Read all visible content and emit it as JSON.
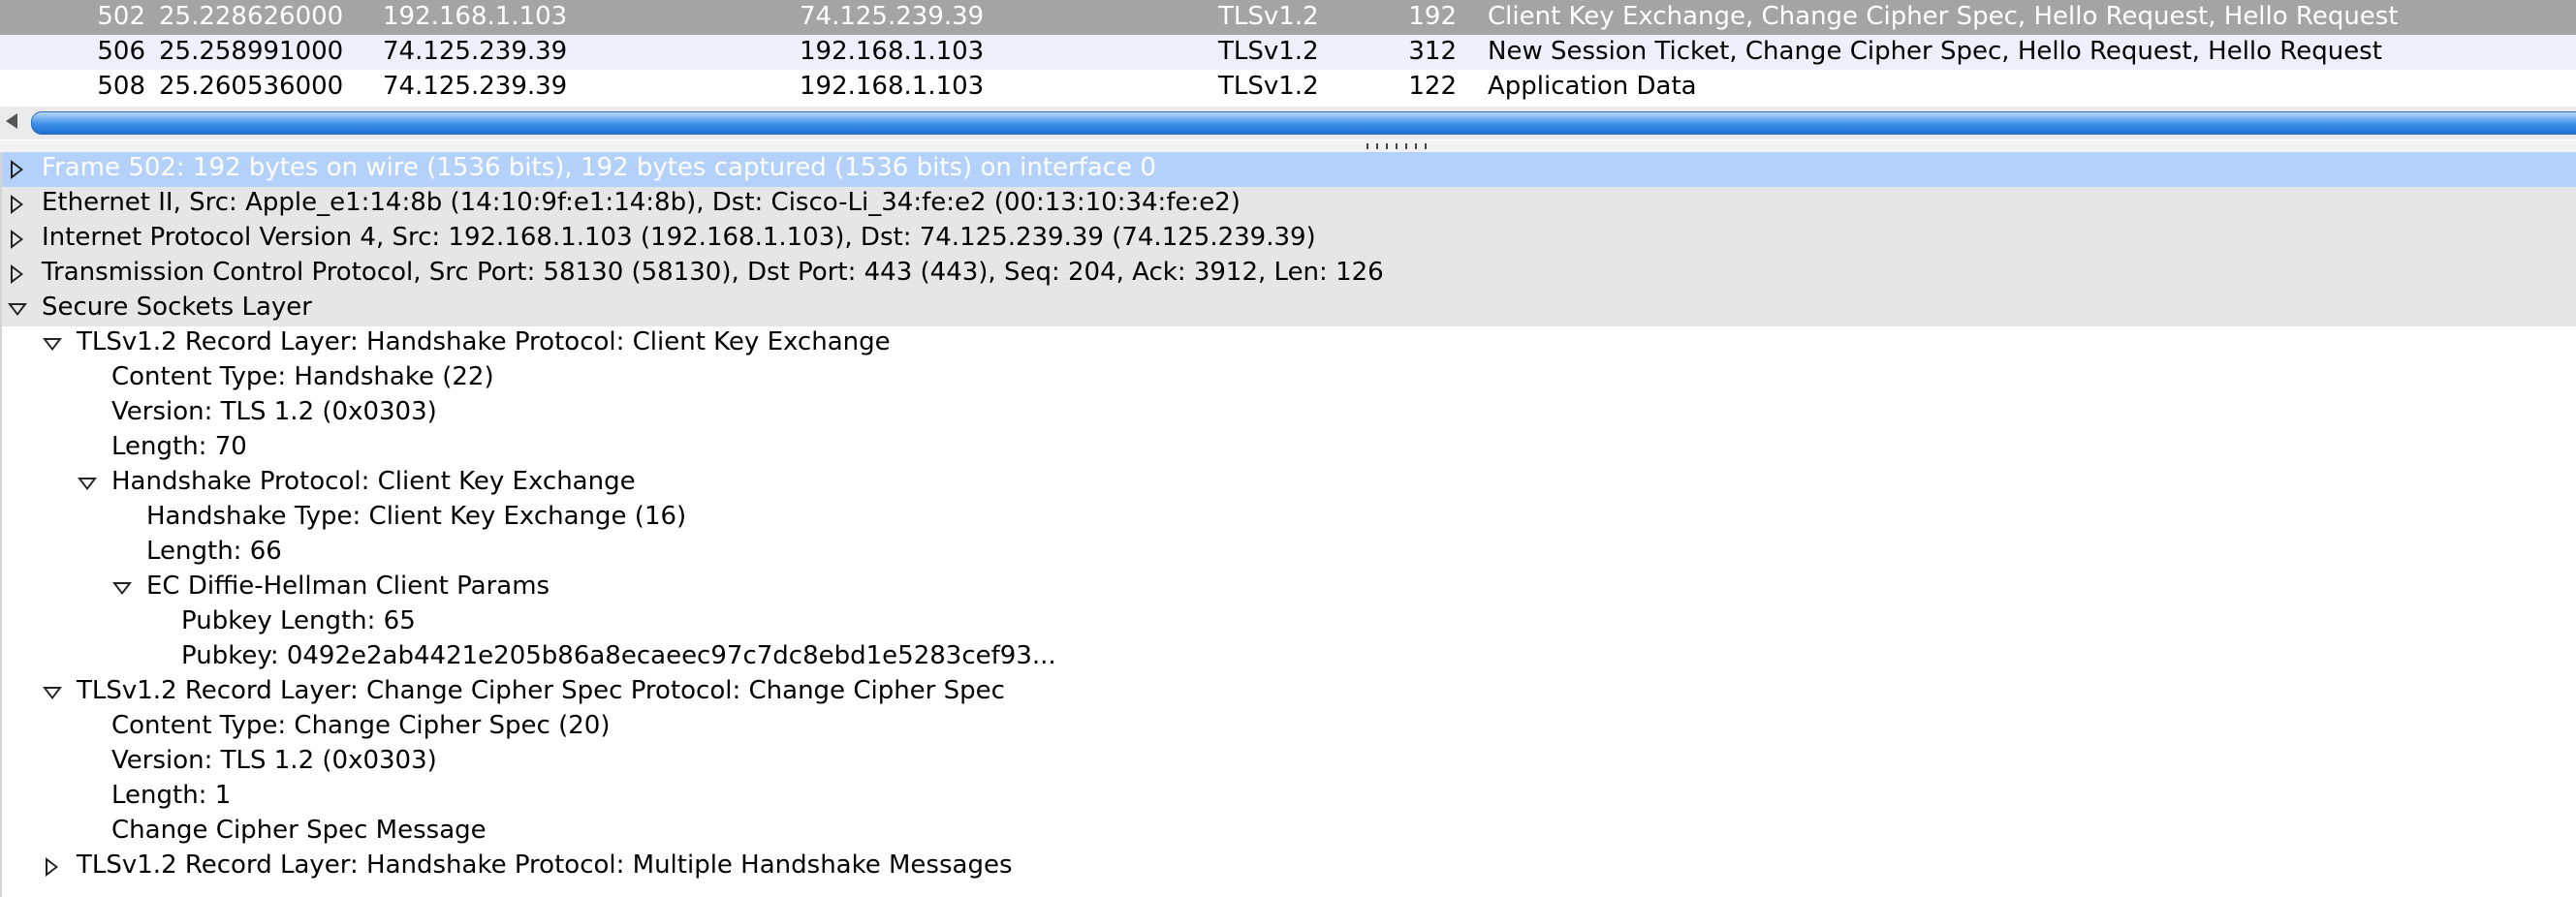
{
  "packet_list": {
    "rows": [
      {
        "no": "502",
        "time": "25.228626000",
        "src": "192.168.1.103",
        "dst": "74.125.239.39",
        "proto": "TLSv1.2",
        "len": "192",
        "info": "Client Key Exchange, Change Cipher Spec, Hello Request, Hello Request",
        "selected": true
      },
      {
        "no": "506",
        "time": "25.258991000",
        "src": "74.125.239.39",
        "dst": "192.168.1.103",
        "proto": "TLSv1.2",
        "len": "312",
        "info": "New Session Ticket, Change Cipher Spec, Hello Request, Hello Request",
        "selected": false
      },
      {
        "no": "508",
        "time": "25.260536000",
        "src": "74.125.239.39",
        "dst": "192.168.1.103",
        "proto": "TLSv1.2",
        "len": "122",
        "info": "Application Data",
        "selected": false
      }
    ]
  },
  "details": {
    "rows": [
      {
        "text": "Frame 502: 192 bytes on wire (1536 bits), 192 bytes captured (1536 bits) on interface 0",
        "level": 0,
        "toggle": "collapsed",
        "selected": true
      },
      {
        "text": "Ethernet II, Src: Apple_e1:14:8b (14:10:9f:e1:14:8b), Dst: Cisco-Li_34:fe:e2 (00:13:10:34:fe:e2)",
        "level": 0,
        "toggle": "collapsed"
      },
      {
        "text": "Internet Protocol Version 4, Src: 192.168.1.103 (192.168.1.103), Dst: 74.125.239.39 (74.125.239.39)",
        "level": 0,
        "toggle": "collapsed"
      },
      {
        "text": "Transmission Control Protocol, Src Port: 58130 (58130), Dst Port: 443 (443), Seq: 204, Ack: 3912, Len: 126",
        "level": 0,
        "toggle": "collapsed"
      },
      {
        "text": "Secure Sockets Layer",
        "level": 0,
        "toggle": "expanded"
      },
      {
        "text": "TLSv1.2 Record Layer: Handshake Protocol: Client Key Exchange",
        "level": 1,
        "toggle": "expanded"
      },
      {
        "text": "Content Type: Handshake (22)",
        "level": 2,
        "toggle": "none"
      },
      {
        "text": "Version: TLS 1.2 (0x0303)",
        "level": 2,
        "toggle": "none"
      },
      {
        "text": "Length: 70",
        "level": 2,
        "toggle": "none"
      },
      {
        "text": "Handshake Protocol: Client Key Exchange",
        "level": 2,
        "toggle": "expanded"
      },
      {
        "text": "Handshake Type: Client Key Exchange (16)",
        "level": 3,
        "toggle": "none"
      },
      {
        "text": "Length: 66",
        "level": 3,
        "toggle": "none"
      },
      {
        "text": "EC Diffie-Hellman Client Params",
        "level": 3,
        "toggle": "expanded"
      },
      {
        "text": "Pubkey Length: 65",
        "level": 4,
        "toggle": "none"
      },
      {
        "text": "Pubkey: 0492e2ab4421e205b86a8ecaeec97c7dc8ebd1e5283cef93...",
        "level": 4,
        "toggle": "none"
      },
      {
        "text": "TLSv1.2 Record Layer: Change Cipher Spec Protocol: Change Cipher Spec",
        "level": 1,
        "toggle": "expanded"
      },
      {
        "text": "Content Type: Change Cipher Spec (20)",
        "level": 2,
        "toggle": "none"
      },
      {
        "text": "Version: TLS 1.2 (0x0303)",
        "level": 2,
        "toggle": "none"
      },
      {
        "text": "Length: 1",
        "level": 2,
        "toggle": "none"
      },
      {
        "text": "Change Cipher Spec Message",
        "level": 2,
        "toggle": "none"
      },
      {
        "text": "TLSv1.2 Record Layer: Handshake Protocol: Multiple Handshake Messages",
        "level": 1,
        "toggle": "collapsed"
      }
    ]
  },
  "colors": {
    "selected_packet_bg": "#a4a4a4",
    "alt_packet_bg": "#edf0fb",
    "selected_tree_bg": "#b3d1fb",
    "gray_tree_bg": "#e6e6e6",
    "scrollbar_thumb": "#3c8ee6"
  },
  "icons": {
    "collapsed": "triangle-right-icon",
    "expanded": "triangle-down-icon",
    "scroll_left": "arrow-left-icon"
  }
}
